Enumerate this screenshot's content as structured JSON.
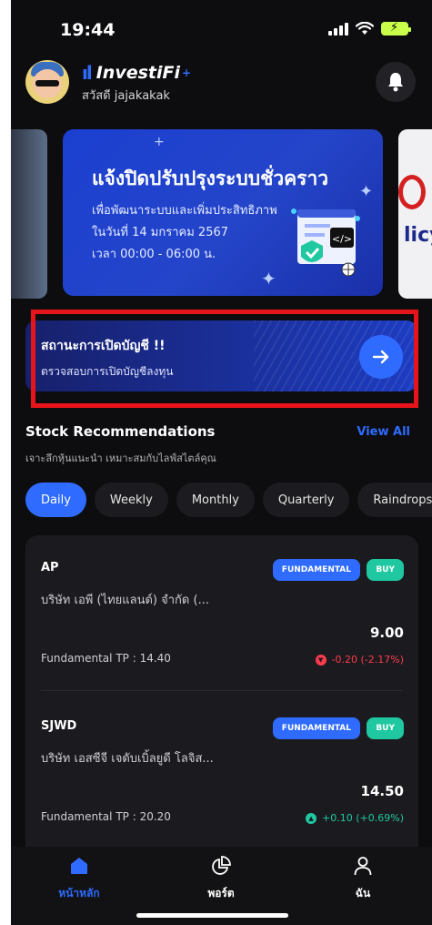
{
  "status_bar": {
    "time": "19:44"
  },
  "header": {
    "brand": "InvestiFi",
    "greeting": "สวัสดี jajakakak"
  },
  "banner": {
    "title": "แจ้งปิดปรับปรุงระบบชั่วคราว",
    "line1": "เพื่อพัฒนาระบบและเพิ่มประสิทธิภาพ",
    "line2": "ในวันที่ 14 มกราคม 2567",
    "line3": "เวลา 00:00 - 06:00 น.",
    "code_tag": "</>",
    "next_card_text": "licy"
  },
  "account_status": {
    "title": "สถานะการเปิดบัญชี !!",
    "subtitle": "ตรวจสอบการเปิดบัญชีลงทุน"
  },
  "recommendations": {
    "title": "Stock Recommendations",
    "view_all": "View All",
    "subtitle": "เจาะลึกหุ้นแนะนำ เหมาะสมกับไลฟ์สไตล์คุณ",
    "tabs": [
      "Daily",
      "Weekly",
      "Monthly",
      "Quarterly",
      "Raindrops"
    ],
    "active_tab": "Daily",
    "items": [
      {
        "symbol": "AP",
        "name": "บริษัท เอพี (ไทยแลนด์) จำกัด (...",
        "badge_type": "FUNDAMENTAL",
        "badge_action": "BUY",
        "price": "9.00",
        "tp_label": "Fundamental TP :",
        "tp_value": "14.40",
        "change": "-0.20 (-2.17%)",
        "direction": "down"
      },
      {
        "symbol": "SJWD",
        "name": "บริษัท เอสซีจี เจดับเบิ้ลยูดี โลจิส...",
        "badge_type": "FUNDAMENTAL",
        "badge_action": "BUY",
        "price": "14.50",
        "tp_label": "Fundamental TP :",
        "tp_value": "20.20",
        "change": "+0.10 (+0.69%)",
        "direction": "up"
      }
    ]
  },
  "bottom_nav": {
    "home": "หน้าหลัก",
    "portfolio": "พอร์ต",
    "me": "ฉัน"
  },
  "colors": {
    "accent": "#2f6bff",
    "buy": "#1fc8a0",
    "down": "#ff3b4d",
    "highlight": "#e8141c",
    "background": "#0d0d0f"
  }
}
